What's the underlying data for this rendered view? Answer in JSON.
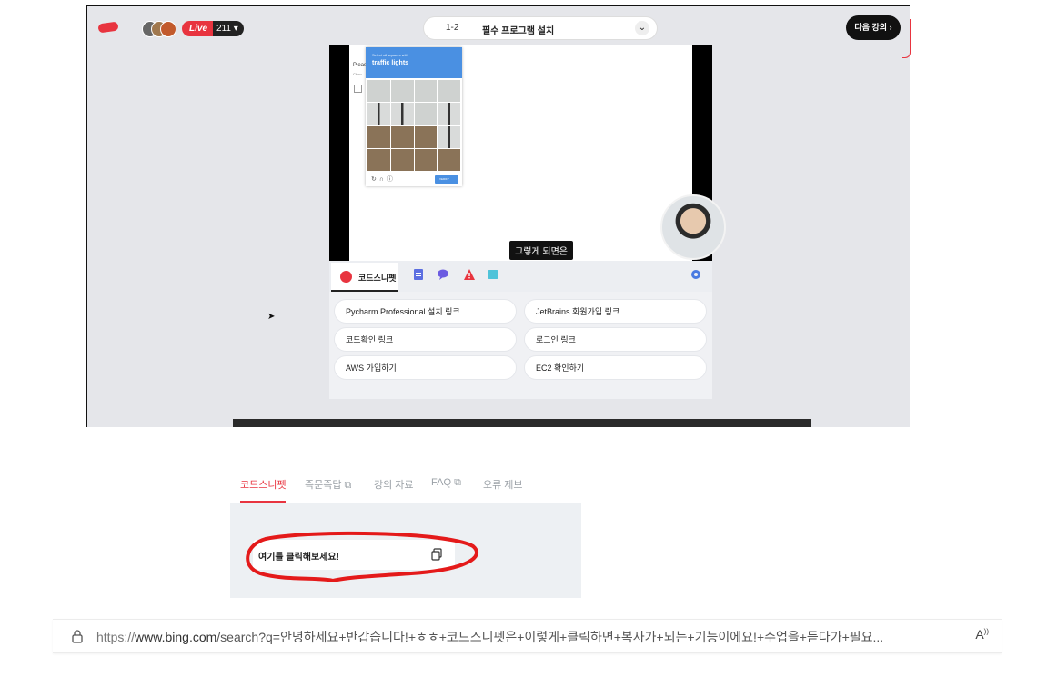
{
  "player": {
    "live_label": "Live",
    "viewer_count": "211",
    "lesson_number": "1-2",
    "lesson_title": "필수 프로그램 설치",
    "next_button": "다음 강의",
    "subtitle": "그렇게 되면은",
    "captcha": {
      "instruction_small": "Select all squares with",
      "instruction_target": "traffic lights",
      "verify_label": "VERIFY",
      "side_label": "Pleas",
      "side_sub": "Choo"
    },
    "snippet_tab": "코드스니펫",
    "links": [
      "Pycharm Professional 설치 링크",
      "JetBrains 회원가입 링크",
      "코드확인 링크",
      "로그인 링크",
      "AWS 가입하기",
      "EC2 확인하기"
    ]
  },
  "tabs": [
    {
      "label": "코드스니펫",
      "active": true
    },
    {
      "label": "즉문즉답",
      "external": true
    },
    {
      "label": "강의 자료"
    },
    {
      "label": "FAQ",
      "external": true
    },
    {
      "label": "오류 제보"
    }
  ],
  "snippet": {
    "text": "여기를 클릭해보세요!"
  },
  "address_bar": {
    "scheme": "https://",
    "host": "www.bing.com",
    "path": "/search?q=안녕하세요+반갑습니다!+ㅎㅎ+코드스니펫은+이렇게+클릭하면+복사가+되는+기능이에요!+수업을+듣다가+필요...",
    "read_aloud": "A"
  },
  "colors": {
    "accent": "#e8343f",
    "captcha_blue": "#4a90e2"
  }
}
